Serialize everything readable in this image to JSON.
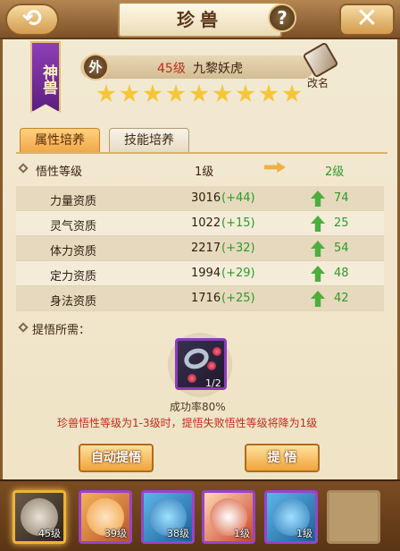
{
  "header": {
    "back_icon": "back-arrow-icon",
    "title": "珍兽",
    "help_label": "?",
    "close_label": "✕"
  },
  "pet": {
    "rank_badge": "神兽",
    "type_badge": "外",
    "level": "45级",
    "name": "九黎妖虎",
    "stars": 9,
    "rename_label": "改名"
  },
  "tabs": [
    {
      "label": "属性培养",
      "active": true
    },
    {
      "label": "技能培养",
      "active": false
    }
  ],
  "comprehension": {
    "label": "悟性等级",
    "current": "1级",
    "next": "2级"
  },
  "stats": [
    {
      "name": "力量资质",
      "base": "3016",
      "bonus": "(+44)",
      "next": "74"
    },
    {
      "name": "灵气资质",
      "base": "1022",
      "bonus": "(+15)",
      "next": "25"
    },
    {
      "name": "体力资质",
      "base": "2217",
      "bonus": "(+32)",
      "next": "54"
    },
    {
      "name": "定力资质",
      "base": "1994",
      "bonus": "(+29)",
      "next": "48"
    },
    {
      "name": "身法资质",
      "base": "1716",
      "bonus": "(+25)",
      "next": "42"
    }
  ],
  "requirement": {
    "label": "提悟所需：",
    "item_count": "1/2",
    "success_rate": "成功率80%",
    "warning": "珍兽悟性等级为1-3级时，提悟失败悟性等级将降为1级"
  },
  "buttons": {
    "auto": "自动提悟",
    "comprehend": "提 悟"
  },
  "pet_list": [
    {
      "level": "45级",
      "selected": true
    },
    {
      "level": "39级",
      "selected": false
    },
    {
      "level": "38级",
      "selected": false
    },
    {
      "level": "1级",
      "selected": false
    },
    {
      "level": "1级",
      "selected": false
    }
  ],
  "colors": {
    "accent": "#f0a43c",
    "level_red": "#c32a1c",
    "gain_green": "#2e9a2a",
    "rank_purple": "#5b1f80"
  }
}
